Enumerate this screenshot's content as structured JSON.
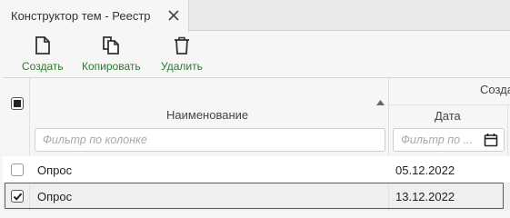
{
  "tab": {
    "title": "Конструктор тем - Реестр"
  },
  "toolbar": {
    "create_label": "Создать",
    "copy_label": "Копировать",
    "delete_label": "Удалить"
  },
  "table": {
    "group_header": "Созда",
    "columns": {
      "name": {
        "title": "Наименование",
        "filter_placeholder": "Фильтр по колонке"
      },
      "date": {
        "title": "Дата",
        "filter_placeholder": "Фильтр по ..."
      }
    },
    "rows": [
      {
        "name": "Опрос",
        "date": "05.12.2022",
        "checked": false
      },
      {
        "name": "Опрос",
        "date": "13.12.2022",
        "checked": true
      }
    ]
  },
  "colors": {
    "accent": "#2c7a2c",
    "selection": "#dd2222"
  }
}
